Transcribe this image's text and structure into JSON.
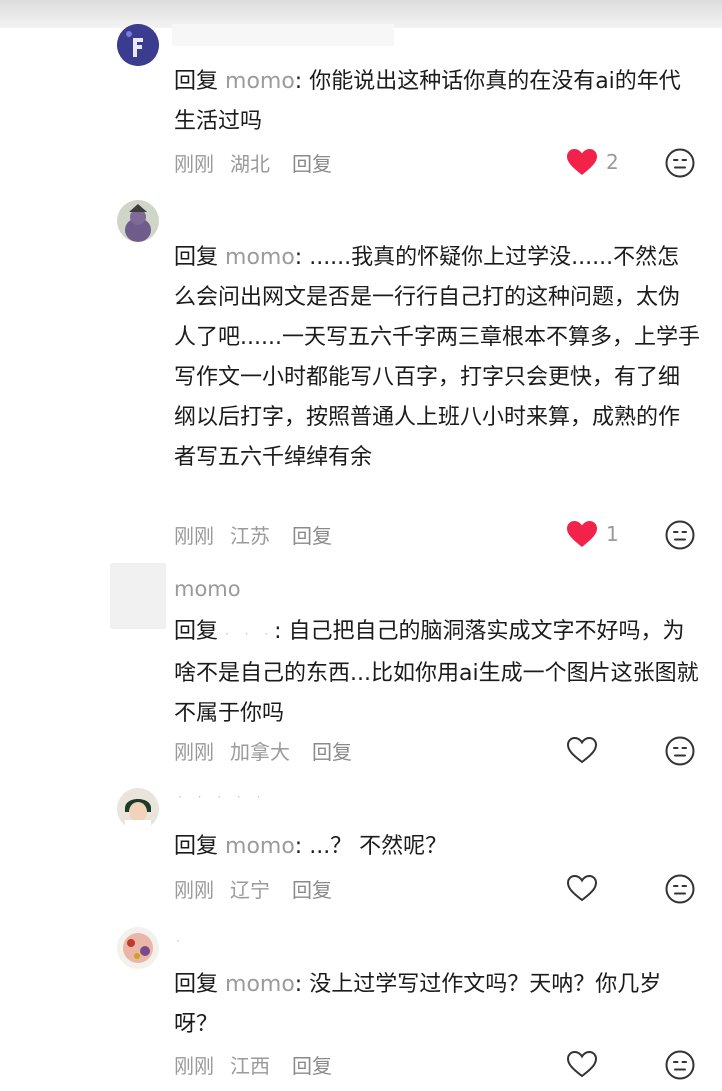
{
  "comments": [
    {
      "reply_prefix": "回复",
      "reply_target": "momo",
      "text": ": 你能说出这种话你真的在没有ai的年代生活过吗",
      "time": "刚刚",
      "location": "湖北",
      "reply_label": "回复",
      "likes": "2",
      "liked": true
    },
    {
      "reply_prefix": "回复",
      "reply_target": "momo",
      "text": ": ......我真的怀疑你上过学没......不然怎么会问出网文是否是一行行自己打的这种问题，太伪人了吧......一天写五六千字两三章根本不算多，上学手写作文一小时都能写八百字，打字只会更快，有了细纲以后打字，按照普通人上班八小时来算，成熟的作者写五六千绰绰有余",
      "time": "刚刚",
      "location": "江苏",
      "reply_label": "回复",
      "likes": "1",
      "liked": true
    },
    {
      "username": "momo",
      "reply_prefix": "回复",
      "reply_target": "",
      "text": ": 自己把自己的脑洞落实成文字不好吗，为啥不是自己的东西...比如你用ai生成一个图片这张图就不属于你吗",
      "time": "刚刚",
      "location": "加拿大",
      "reply_label": "回复",
      "likes": "",
      "liked": false
    },
    {
      "reply_prefix": "回复",
      "reply_target": "momo",
      "text": ": ...？ 不然呢？",
      "time": "刚刚",
      "location": "辽宁",
      "reply_label": "回复",
      "likes": "",
      "liked": false
    },
    {
      "reply_prefix": "回复",
      "reply_target": "momo",
      "text": ": 没上过学写过作文吗？天呐？你几岁呀？",
      "time": "刚刚",
      "location": "江西",
      "reply_label": "回复",
      "likes": "",
      "liked": false
    }
  ],
  "colors": {
    "like_active": "#f2224a",
    "muted_text": "#9a9a9a"
  },
  "icons": {
    "like": "heart-icon",
    "emoji": "neutral-face-icon"
  }
}
